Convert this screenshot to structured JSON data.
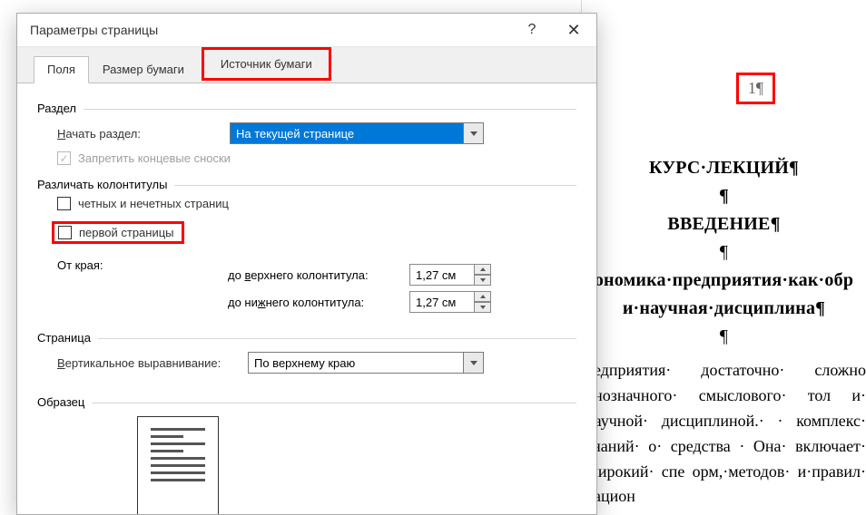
{
  "dialog": {
    "title": "Параметры страницы",
    "help": "?",
    "close": "✕"
  },
  "tabs": {
    "fields": "Поля",
    "papersize": "Размер бумаги",
    "papersource": "Источник бумаги"
  },
  "section": {
    "group": "Раздел",
    "start_label_pre": "Н",
    "start_label": "ачать раздел:",
    "start_value": "На текущей странице",
    "suppress_endnotes": "Запретить концевые сноски"
  },
  "headers": {
    "group": "Различать колонтитулы",
    "odd_even_pre": "ч",
    "odd_even": "етных и нечетных страниц",
    "first_page_pre": "перв",
    "first_page_ul": "о",
    "first_page_post": "й страницы",
    "from_edge": "От края:",
    "header_lbl_pre": "до ",
    "header_lbl_ul": "в",
    "header_lbl_post": "ерхнего колонтитула:",
    "footer_lbl_pre": "до ни",
    "footer_lbl_ul": "ж",
    "footer_lbl_post": "него колонтитула:",
    "header_val": "1,27 см",
    "footer_val": "1,27 см"
  },
  "page": {
    "group": "Страница",
    "valign_pre": "В",
    "valign_post": "ертикальное выравнивание:",
    "valign_value": "По верхнему краю"
  },
  "preview": {
    "group": "Образец"
  },
  "doc": {
    "pagenum": "1¶",
    "l1": "КУРС·ЛЕКЦИЙ¶",
    "l2": "¶",
    "l3": "ВВЕДЕНИЕ¶",
    "l4": "¶",
    "l5": "ономика·предприятия·как·обр",
    "l6": "и·научная·дисциплина¶",
    "l7": "¶",
    "p1": "редприятия· достаточно· сложно днозначного· смыслового· тол и· научной· дисциплиной.· · комплекс· знаний· о· средства · Она· включает· широкий· спе орм,·методов· и·правил· рацион"
  }
}
